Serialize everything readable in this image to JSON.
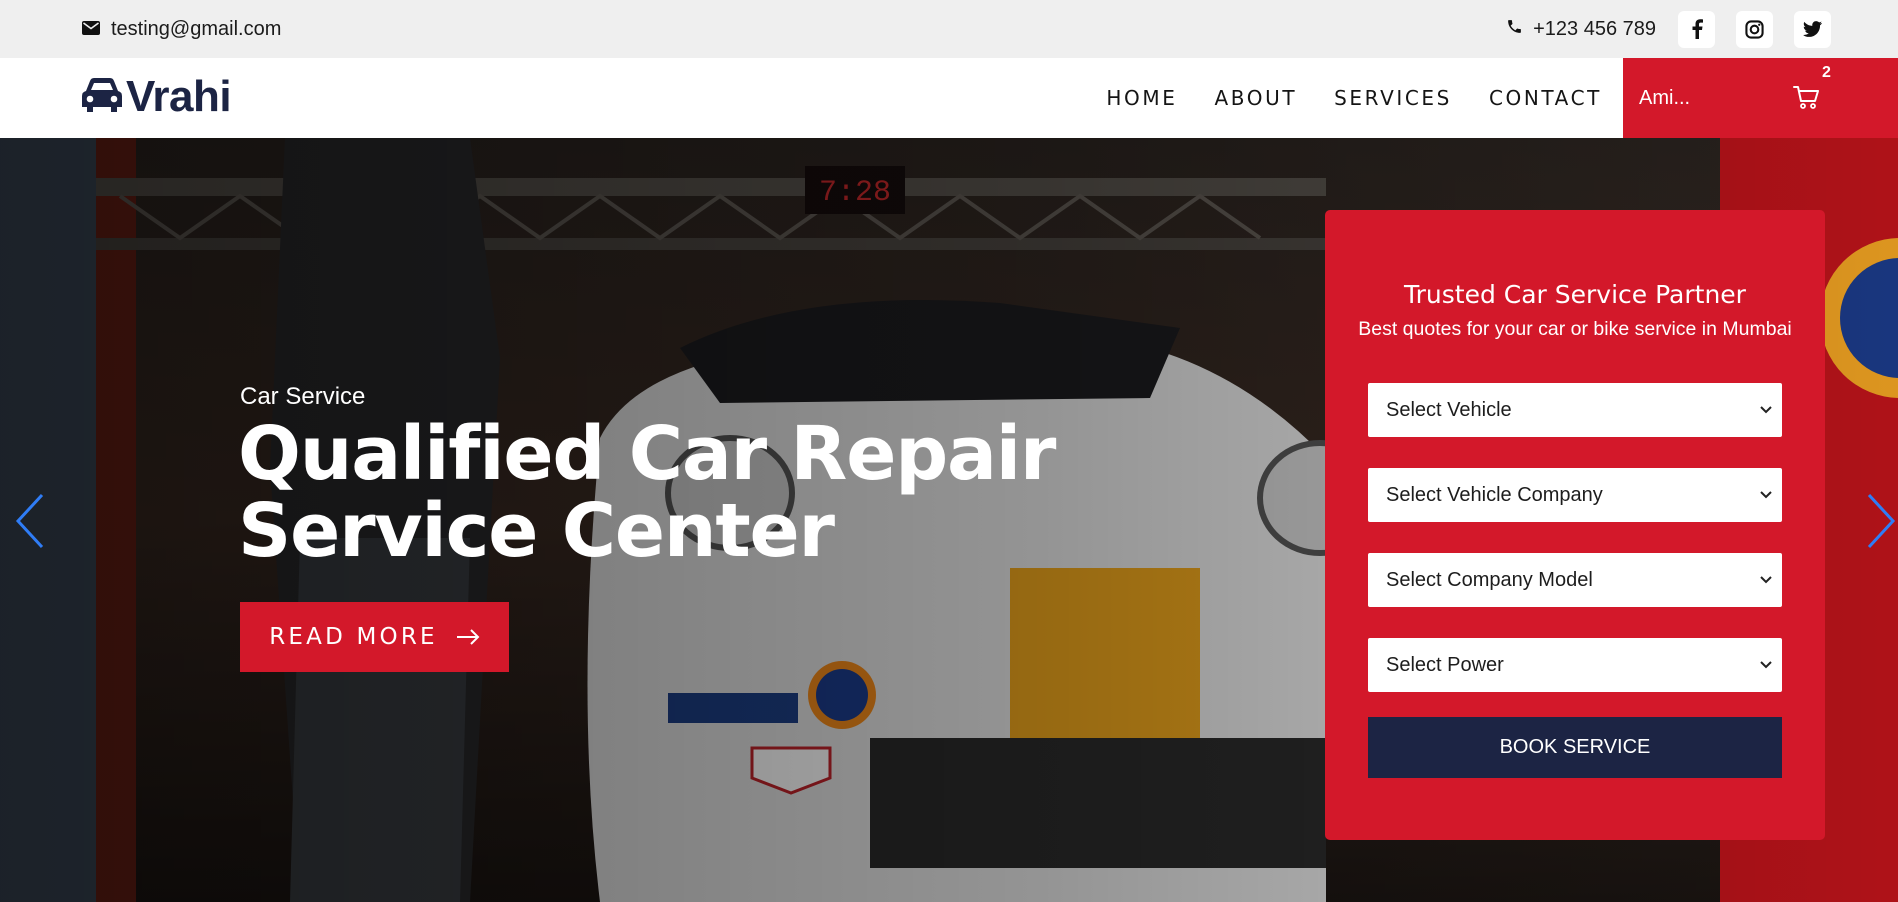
{
  "topbar": {
    "email": "testing@gmail.com",
    "phone": "+123 456 789",
    "email_icon": "mail-icon",
    "phone_icon": "phone-icon",
    "socials": [
      "facebook-icon",
      "instagram-icon",
      "twitter-icon"
    ]
  },
  "nav": {
    "logo_text": "Vrahi",
    "logo_icon": "car-icon",
    "menu": [
      "HOME",
      "ABOUT",
      "SERVICES",
      "CONTACT"
    ],
    "account_name": "Ami...",
    "cart_count": "2",
    "cart_icon": "cart-icon"
  },
  "hero": {
    "subtitle": "Car Service",
    "title": "Qualified Car Repair Service Center",
    "read_more": "READ MORE"
  },
  "form": {
    "title": "Trusted Car Service Partner",
    "subtitle": "Best quotes for your car or bike service in Mumbai",
    "selects": [
      "Select Vehicle",
      "Select Vehicle Company",
      "Select Company Model",
      "Select Power"
    ],
    "submit": "BOOK SERVICE"
  },
  "colors": {
    "brand_red": "#d3182a",
    "navy": "#1c2444",
    "topbar_bg": "#efefef"
  }
}
